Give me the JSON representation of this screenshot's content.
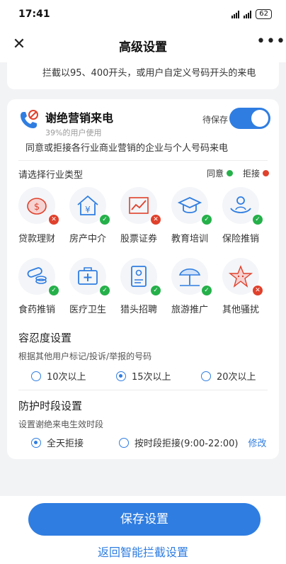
{
  "status": {
    "time": "17:41",
    "battery": "62"
  },
  "nav": {
    "title": "高级设置",
    "close": "✕",
    "more": "•••"
  },
  "prev": {
    "text": "拦截以95、400开头，或用户自定义号码开头的来电"
  },
  "marketing": {
    "title": "谢绝营销来电",
    "users": "39%的用户使用",
    "desc": "同意或拒接各行业商业营销的企业与个人号码来电",
    "pending": "待保存",
    "enabled": true
  },
  "industry": {
    "title": "请选择行业类型",
    "legend_agree": "同意",
    "legend_reject": "拒接",
    "agree_color": "#25b04a",
    "reject_color": "#e0412c",
    "items": [
      {
        "label": "贷款理财",
        "status": "reject",
        "icon": "piggy-bank-icon"
      },
      {
        "label": "房产中介",
        "status": "agree",
        "icon": "house-yen-icon"
      },
      {
        "label": "股票证券",
        "status": "reject",
        "icon": "stock-chart-icon"
      },
      {
        "label": "教育培训",
        "status": "agree",
        "icon": "graduation-cap-icon"
      },
      {
        "label": "保险推销",
        "status": "agree",
        "icon": "insurance-hands-icon"
      },
      {
        "label": "食药推销",
        "status": "agree",
        "icon": "pills-icon"
      },
      {
        "label": "医疗卫生",
        "status": "agree",
        "icon": "medical-kit-icon"
      },
      {
        "label": "猎头招聘",
        "status": "agree",
        "icon": "resume-icon"
      },
      {
        "label": "旅游推广",
        "status": "agree",
        "icon": "beach-umbrella-icon"
      },
      {
        "label": "其他骚扰",
        "status": "reject",
        "icon": "star-face-icon"
      }
    ]
  },
  "tolerance": {
    "title": "容忍度设置",
    "desc": "根据其他用户标记/投诉/举报的号码",
    "options": [
      "10次以上",
      "15次以上",
      "20次以上"
    ],
    "selected": 1
  },
  "protect": {
    "title": "防护时段设置",
    "desc": "设置谢绝来电生效时段",
    "options": [
      "全天拒接",
      "按时段拒接(9:00-22:00)"
    ],
    "modify": "修改",
    "selected": 0
  },
  "footer": {
    "save": "保存设置",
    "back": "返回智能拦截设置"
  },
  "colors": {
    "accent": "#2f7de1"
  }
}
